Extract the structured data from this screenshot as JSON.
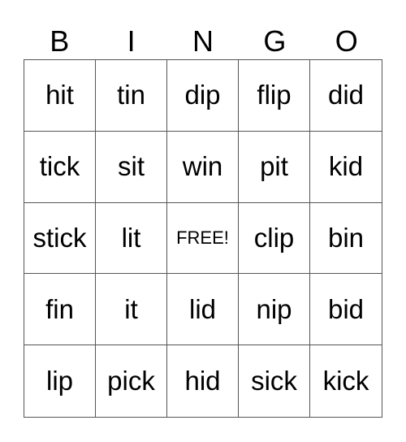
{
  "header": [
    "B",
    "I",
    "N",
    "G",
    "O"
  ],
  "rows": [
    [
      "hit",
      "tin",
      "dip",
      "flip",
      "did"
    ],
    [
      "tick",
      "sit",
      "win",
      "pit",
      "kid"
    ],
    [
      "stick",
      "lit",
      "FREE!",
      "clip",
      "bin"
    ],
    [
      "fin",
      "it",
      "lid",
      "nip",
      "bid"
    ],
    [
      "lip",
      "pick",
      "hid",
      "sick",
      "kick"
    ]
  ]
}
